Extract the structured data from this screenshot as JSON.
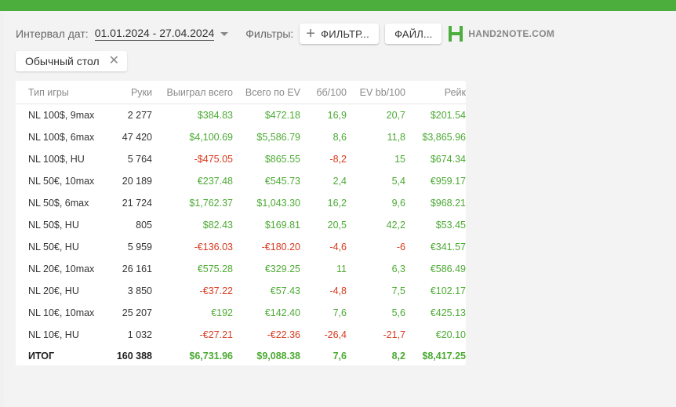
{
  "toolbar": {
    "interval_label": "Интервал дат:",
    "date_range": "01.01.2024 - 27.04.2024",
    "filters_label": "Фильтры:",
    "filter_button": "ФИЛЬТР...",
    "file_button": "ФАЙЛ...",
    "logo_text": "HAND2NOTE.COM"
  },
  "chip": {
    "label": "Обычный стол"
  },
  "colors": {
    "accent": "#4cae3c",
    "positive": "#4caa34",
    "negative": "#d8391e"
  },
  "table": {
    "headers": [
      "Тип игры",
      "Руки",
      "Выиграл всего",
      "Всего по EV",
      "бб/100",
      "EV bb/100",
      "Рейк"
    ],
    "rows": [
      {
        "game": "NL 100$, 9max",
        "hands": "2 277",
        "won": "$384.83",
        "ev": "$472.18",
        "bb100": "16,9",
        "evbb100": "20,7",
        "rake": "$201.54"
      },
      {
        "game": "NL 100$, 6max",
        "hands": "47 420",
        "won": "$4,100.69",
        "ev": "$5,586.79",
        "bb100": "8,6",
        "evbb100": "11,8",
        "rake": "$3,865.96"
      },
      {
        "game": "NL 100$, HU",
        "hands": "5 764",
        "won": "-$475.05",
        "ev": "$865.55",
        "bb100": "-8,2",
        "evbb100": "15",
        "rake": "$674.34"
      },
      {
        "game": "NL 50€, 10max",
        "hands": "20 189",
        "won": "€237.48",
        "ev": "€545.73",
        "bb100": "2,4",
        "evbb100": "5,4",
        "rake": "€959.17"
      },
      {
        "game": "NL 50$, 6max",
        "hands": "21 724",
        "won": "$1,762.37",
        "ev": "$1,043.30",
        "bb100": "16,2",
        "evbb100": "9,6",
        "rake": "$968.21"
      },
      {
        "game": "NL 50$, HU",
        "hands": "805",
        "won": "$82.43",
        "ev": "$169.81",
        "bb100": "20,5",
        "evbb100": "42,2",
        "rake": "$53.45"
      },
      {
        "game": "NL 50€, HU",
        "hands": "5 959",
        "won": "-€136.03",
        "ev": "-€180.20",
        "bb100": "-4,6",
        "evbb100": "-6",
        "rake": "€341.57"
      },
      {
        "game": "NL 20€, 10max",
        "hands": "26 161",
        "won": "€575.28",
        "ev": "€329.25",
        "bb100": "11",
        "evbb100": "6,3",
        "rake": "€586.49"
      },
      {
        "game": "NL 20€, HU",
        "hands": "3 850",
        "won": "-€37.22",
        "ev": "€57.43",
        "bb100": "-4,8",
        "evbb100": "7,5",
        "rake": "€102.17"
      },
      {
        "game": "NL 10€, 10max",
        "hands": "25 207",
        "won": "€192",
        "ev": "€142.40",
        "bb100": "7,6",
        "evbb100": "5,6",
        "rake": "€425.13"
      },
      {
        "game": "NL 10€, HU",
        "hands": "1 032",
        "won": "-€27.21",
        "ev": "-€22.36",
        "bb100": "-26,4",
        "evbb100": "-21,7",
        "rake": "€20.10"
      }
    ],
    "total": {
      "game": "ИТОГ",
      "hands": "160 388",
      "won": "$6,731.96",
      "ev": "$9,088.38",
      "bb100": "7,6",
      "evbb100": "8,2",
      "rake": "$8,417.25"
    }
  }
}
